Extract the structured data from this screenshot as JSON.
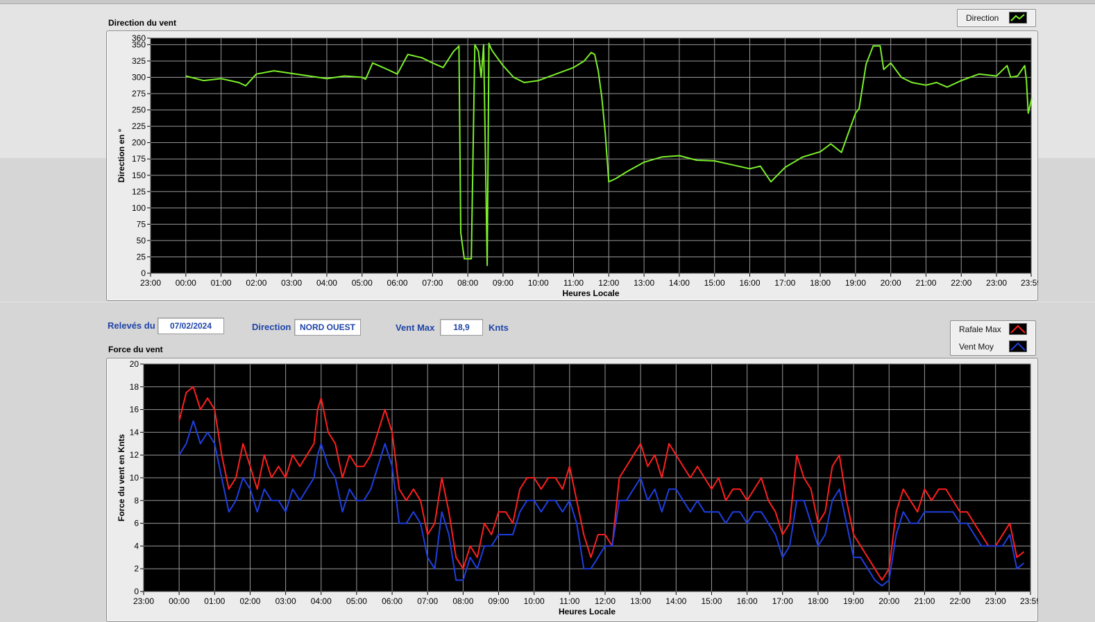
{
  "colors": {
    "direction": "#7cf02a",
    "gust": "#ff1f1f",
    "average": "#1f3fe0",
    "plot_background": "#000000",
    "grid": "#9a9a9a",
    "label_blue": "#1f44a8"
  },
  "direction_panel": {
    "title": "Direction du vent",
    "legend": [
      {
        "label": "Direction",
        "color": "#7cf02a"
      }
    ]
  },
  "controls": {
    "date_label": "Relevés du",
    "date_value": "07/02/2024",
    "direction_label": "Direction",
    "direction_value": "NORD OUEST",
    "vmax_label": "Vent Max",
    "vmax_value": "18,9",
    "vmax_unit": "Knts"
  },
  "force_panel": {
    "title": "Force du vent",
    "legend": [
      {
        "label": "Rafale Max",
        "color": "#ff1f1f"
      },
      {
        "label": "Vent Moy",
        "color": "#1f3fe0"
      }
    ]
  },
  "chart_data": [
    {
      "type": "line",
      "xlabel": "Heures Locale",
      "ylabel": "Direction en °",
      "x_ticks": [
        "23:00",
        "00:00",
        "01:00",
        "02:00",
        "03:00",
        "04:00",
        "05:00",
        "06:00",
        "07:00",
        "08:00",
        "09:00",
        "10:00",
        "11:00",
        "12:00",
        "13:00",
        "14:00",
        "15:00",
        "16:00",
        "17:00",
        "18:00",
        "19:00",
        "20:00",
        "21:00",
        "22:00",
        "23:00",
        "23:59"
      ],
      "y_ticks": [
        0,
        25,
        50,
        75,
        100,
        125,
        150,
        175,
        200,
        225,
        250,
        275,
        300,
        325,
        350,
        360
      ],
      "ylim": [
        0,
        360
      ],
      "grid": true,
      "legend_position": "top-right",
      "series": [
        {
          "name": "Direction",
          "color": "#7cf02a",
          "x_hours": [
            0.0,
            0.5,
            1.0,
            1.5,
            1.7,
            2.0,
            2.5,
            3.0,
            3.5,
            4.0,
            4.5,
            5.0,
            5.1,
            5.3,
            5.6,
            6.0,
            6.3,
            6.7,
            7.0,
            7.3,
            7.6,
            7.7,
            7.75,
            7.8,
            7.9,
            8.0,
            8.1,
            8.2,
            8.3,
            8.38,
            8.45,
            8.55,
            8.6,
            8.65,
            8.7,
            9.0,
            9.3,
            9.6,
            10.0,
            10.5,
            11.0,
            11.3,
            11.5,
            11.6,
            11.7,
            11.8,
            11.9,
            12.0,
            12.2,
            12.5,
            13.0,
            13.5,
            14.0,
            14.5,
            15.0,
            15.5,
            16.0,
            16.3,
            16.6,
            17.0,
            17.5,
            18.0,
            18.3,
            18.6,
            18.8,
            19.0,
            19.1,
            19.3,
            19.5,
            19.7,
            19.8,
            20.0,
            20.3,
            20.6,
            21.0,
            21.3,
            21.6,
            22.0,
            22.5,
            23.0,
            23.3,
            23.4,
            23.6,
            23.8,
            23.85,
            23.9,
            24.0
          ],
          "y": [
            302,
            295,
            298,
            292,
            287,
            305,
            310,
            306,
            302,
            298,
            302,
            300,
            297,
            322,
            315,
            305,
            335,
            330,
            322,
            315,
            340,
            345,
            348,
            62,
            22,
            22,
            22,
            350,
            340,
            300,
            350,
            12,
            352,
            345,
            340,
            318,
            300,
            292,
            295,
            305,
            315,
            325,
            338,
            335,
            310,
            270,
            215,
            140,
            145,
            155,
            170,
            178,
            180,
            173,
            172,
            166,
            160,
            164,
            140,
            162,
            178,
            186,
            198,
            185,
            215,
            245,
            252,
            320,
            348,
            348,
            312,
            322,
            300,
            292,
            288,
            292,
            285,
            295,
            305,
            302,
            318,
            300,
            302,
            318,
            295,
            245,
            268
          ]
        }
      ]
    },
    {
      "type": "line",
      "xlabel": "Heures Locale",
      "ylabel": "Force du vent en Knts",
      "x_ticks": [
        "23:00",
        "00:00",
        "01:00",
        "02:00",
        "03:00",
        "04:00",
        "05:00",
        "06:00",
        "07:00",
        "08:00",
        "09:00",
        "10:00",
        "11:00",
        "12:00",
        "13:00",
        "14:00",
        "15:00",
        "16:00",
        "17:00",
        "18:00",
        "19:00",
        "20:00",
        "21:00",
        "22:00",
        "23:00",
        "23:59"
      ],
      "y_ticks": [
        0,
        2,
        4,
        6,
        8,
        10,
        12,
        14,
        16,
        18,
        20
      ],
      "ylim": [
        0,
        20
      ],
      "grid": true,
      "legend_position": "top-right",
      "series": [
        {
          "name": "Rafale Max",
          "color": "#ff1f1f",
          "x_hours": [
            0.0,
            0.2,
            0.4,
            0.6,
            0.8,
            1.0,
            1.2,
            1.4,
            1.6,
            1.8,
            2.0,
            2.2,
            2.4,
            2.6,
            2.8,
            3.0,
            3.2,
            3.4,
            3.6,
            3.8,
            3.9,
            4.0,
            4.2,
            4.4,
            4.6,
            4.8,
            5.0,
            5.2,
            5.4,
            5.6,
            5.8,
            6.0,
            6.2,
            6.4,
            6.6,
            6.8,
            7.0,
            7.2,
            7.4,
            7.6,
            7.8,
            8.0,
            8.2,
            8.4,
            8.6,
            8.8,
            9.0,
            9.2,
            9.4,
            9.6,
            9.8,
            10.0,
            10.2,
            10.4,
            10.6,
            10.8,
            11.0,
            11.2,
            11.4,
            11.6,
            11.8,
            12.0,
            12.2,
            12.4,
            12.6,
            12.8,
            13.0,
            13.2,
            13.4,
            13.6,
            13.8,
            14.0,
            14.2,
            14.4,
            14.6,
            14.8,
            15.0,
            15.2,
            15.4,
            15.6,
            15.8,
            16.0,
            16.2,
            16.4,
            16.6,
            16.8,
            17.0,
            17.2,
            17.4,
            17.6,
            17.8,
            18.0,
            18.2,
            18.4,
            18.6,
            18.8,
            19.0,
            19.2,
            19.4,
            19.6,
            19.8,
            20.0,
            20.2,
            20.4,
            20.6,
            20.8,
            21.0,
            21.2,
            21.4,
            21.6,
            21.8,
            22.0,
            22.2,
            22.4,
            22.6,
            22.8,
            23.0,
            23.2,
            23.4,
            23.6,
            23.8,
            24.0
          ],
          "y": [
            15,
            17.5,
            18,
            16,
            17,
            16,
            12,
            9,
            10,
            13,
            11,
            9,
            12,
            10,
            11,
            10,
            12,
            11,
            12,
            13,
            16,
            17,
            14,
            13,
            10,
            12,
            11,
            11,
            12,
            14,
            16,
            14,
            9,
            8,
            9,
            8,
            5,
            6,
            10,
            7,
            3,
            2,
            4,
            3,
            6,
            5,
            7,
            7,
            6,
            9,
            10,
            10,
            9,
            10,
            10,
            9,
            11,
            8,
            5,
            3,
            5,
            5,
            4,
            10,
            11,
            12,
            13,
            11,
            12,
            10,
            13,
            12,
            11,
            10,
            11,
            10,
            9,
            10,
            8,
            9,
            9,
            8,
            9,
            10,
            8,
            7,
            5,
            6,
            12,
            10,
            9,
            6,
            7,
            11,
            12,
            8,
            5,
            4,
            3,
            2,
            1,
            2,
            7,
            9,
            8,
            7,
            9,
            8,
            9,
            9,
            8,
            7,
            7,
            6,
            5,
            4,
            4,
            5,
            6,
            3,
            3.5
          ],
          "peak": 18.9
        },
        {
          "name": "Vent Moy",
          "color": "#1f3fe0",
          "x_hours": [
            0.0,
            0.2,
            0.4,
            0.6,
            0.8,
            1.0,
            1.2,
            1.4,
            1.6,
            1.8,
            2.0,
            2.2,
            2.4,
            2.6,
            2.8,
            3.0,
            3.2,
            3.4,
            3.6,
            3.8,
            3.9,
            4.0,
            4.2,
            4.4,
            4.6,
            4.8,
            5.0,
            5.2,
            5.4,
            5.6,
            5.8,
            6.0,
            6.2,
            6.4,
            6.6,
            6.8,
            7.0,
            7.2,
            7.4,
            7.6,
            7.8,
            8.0,
            8.2,
            8.4,
            8.6,
            8.8,
            9.0,
            9.2,
            9.4,
            9.6,
            9.8,
            10.0,
            10.2,
            10.4,
            10.6,
            10.8,
            11.0,
            11.2,
            11.4,
            11.6,
            11.8,
            12.0,
            12.2,
            12.4,
            12.6,
            12.8,
            13.0,
            13.2,
            13.4,
            13.6,
            13.8,
            14.0,
            14.2,
            14.4,
            14.6,
            14.8,
            15.0,
            15.2,
            15.4,
            15.6,
            15.8,
            16.0,
            16.2,
            16.4,
            16.6,
            16.8,
            17.0,
            17.2,
            17.4,
            17.6,
            17.8,
            18.0,
            18.2,
            18.4,
            18.6,
            18.8,
            19.0,
            19.2,
            19.4,
            19.6,
            19.8,
            20.0,
            20.2,
            20.4,
            20.6,
            20.8,
            21.0,
            21.2,
            21.4,
            21.6,
            21.8,
            22.0,
            22.2,
            22.4,
            22.6,
            22.8,
            23.0,
            23.2,
            23.4,
            23.6,
            23.8,
            24.0
          ],
          "y": [
            12,
            13,
            15,
            13,
            14,
            13,
            10,
            7,
            8,
            10,
            9,
            7,
            9,
            8,
            8,
            7,
            9,
            8,
            9,
            10,
            12,
            13,
            11,
            10,
            7,
            9,
            8,
            8,
            9,
            11,
            13,
            11,
            6,
            6,
            7,
            6,
            3,
            2,
            7,
            5,
            1,
            1,
            3,
            2,
            4,
            4,
            5,
            5,
            5,
            7,
            8,
            8,
            7,
            8,
            8,
            7,
            8,
            6,
            2,
            2,
            3,
            4,
            4,
            8,
            8,
            9,
            10,
            8,
            9,
            7,
            9,
            9,
            8,
            7,
            8,
            7,
            7,
            7,
            6,
            7,
            7,
            6,
            7,
            7,
            6,
            5,
            3,
            4,
            8,
            8,
            6,
            4,
            5,
            8,
            9,
            6,
            3,
            3,
            2,
            1,
            0.5,
            1,
            5,
            7,
            6,
            6,
            7,
            7,
            7,
            7,
            7,
            6,
            6,
            5,
            4,
            4,
            4,
            4,
            5,
            2,
            2.5
          ]
        }
      ]
    }
  ]
}
